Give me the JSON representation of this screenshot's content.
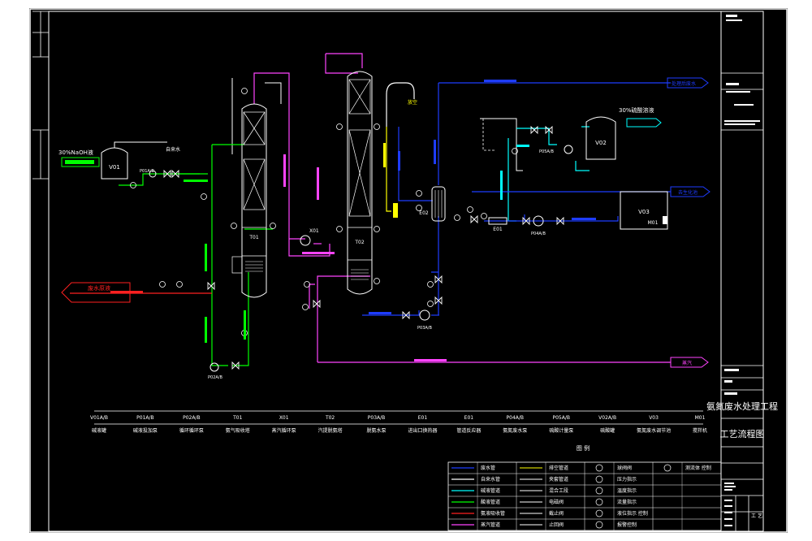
{
  "title_block": {
    "project": "氨氮废水处理工程",
    "drawing": "工艺流程图",
    "scale_label": "工 艺"
  },
  "labels": {
    "tank_v01_note": "30%NaOH液",
    "tank_v01_tag": "V01",
    "tank_v02_note": "30%硫酸溶液",
    "tank_v02_tag": "V02",
    "tank_v03_tag": "V03",
    "mixer_tag": "M01",
    "feed_in": "废水原液",
    "feed_out": "处理后废水",
    "to_ammonia": "硫酸铵",
    "to_process": "去生化池",
    "tap_water": "自来水",
    "vent": "放空",
    "steam_in": "蒸汽",
    "to_tail": "氨氮废水",
    "col_t01": "T01",
    "col_t02": "T02",
    "hx_e01": "E01",
    "hx_e02": "E02",
    "vessel_x01": "X01",
    "pump_p01": "P01A/B",
    "pump_p02": "P02A/B",
    "pump_p03": "P03A/B",
    "pump_p04": "P04A/B",
    "pump_p05": "P05A/B"
  },
  "equipment_list": [
    {
      "tag": "V01A/B",
      "name": "碱液罐"
    },
    {
      "tag": "P01A/B",
      "name": "碱液投加泵"
    },
    {
      "tag": "P02A/B",
      "name": "循环循环泵"
    },
    {
      "tag": "T01",
      "name": "氨气吸收塔"
    },
    {
      "tag": "X01",
      "name": "蒸汽循环泵"
    },
    {
      "tag": "T02",
      "name": "汽提脱氨塔"
    },
    {
      "tag": "P03A/B",
      "name": "脱氨水泵"
    },
    {
      "tag": "E01",
      "name": "进出口换热器"
    },
    {
      "tag": "E01",
      "name": "管道反应器"
    },
    {
      "tag": "P04A/B",
      "name": "氨氮废水泵"
    },
    {
      "tag": "P05A/B",
      "name": "硫酸计量泵"
    },
    {
      "tag": "V02A/B",
      "name": "硫酸罐"
    },
    {
      "tag": "V03",
      "name": "氨氮废水调节池"
    },
    {
      "tag": "M01",
      "name": "搅拌机"
    }
  ],
  "legend": {
    "title": "图 例",
    "col1": [
      "废水管",
      "自来水管",
      "碱液管道",
      "酸液管道",
      "氨液吸收管",
      "蒸汽管道"
    ],
    "col2": [
      "排空管道",
      "夹套管道",
      "混合工段",
      "电磁阀",
      "截止阀",
      "止回阀"
    ],
    "col3": [
      "球阀阀",
      "压力指示",
      "温度指示",
      "流量指示",
      "液位指示 控制",
      "报警控制"
    ],
    "col4": [
      "测流体 控制"
    ]
  },
  "colors": {
    "background": "#000000",
    "frame": "#ffffff",
    "wastewater": "#1e3cff",
    "tap_water": "#ffffff",
    "alkali": "#00ff00",
    "acid": "#00ffff",
    "ammonia": "#ff2020",
    "steam": "#ff44ff",
    "vent": "#ffff00"
  }
}
